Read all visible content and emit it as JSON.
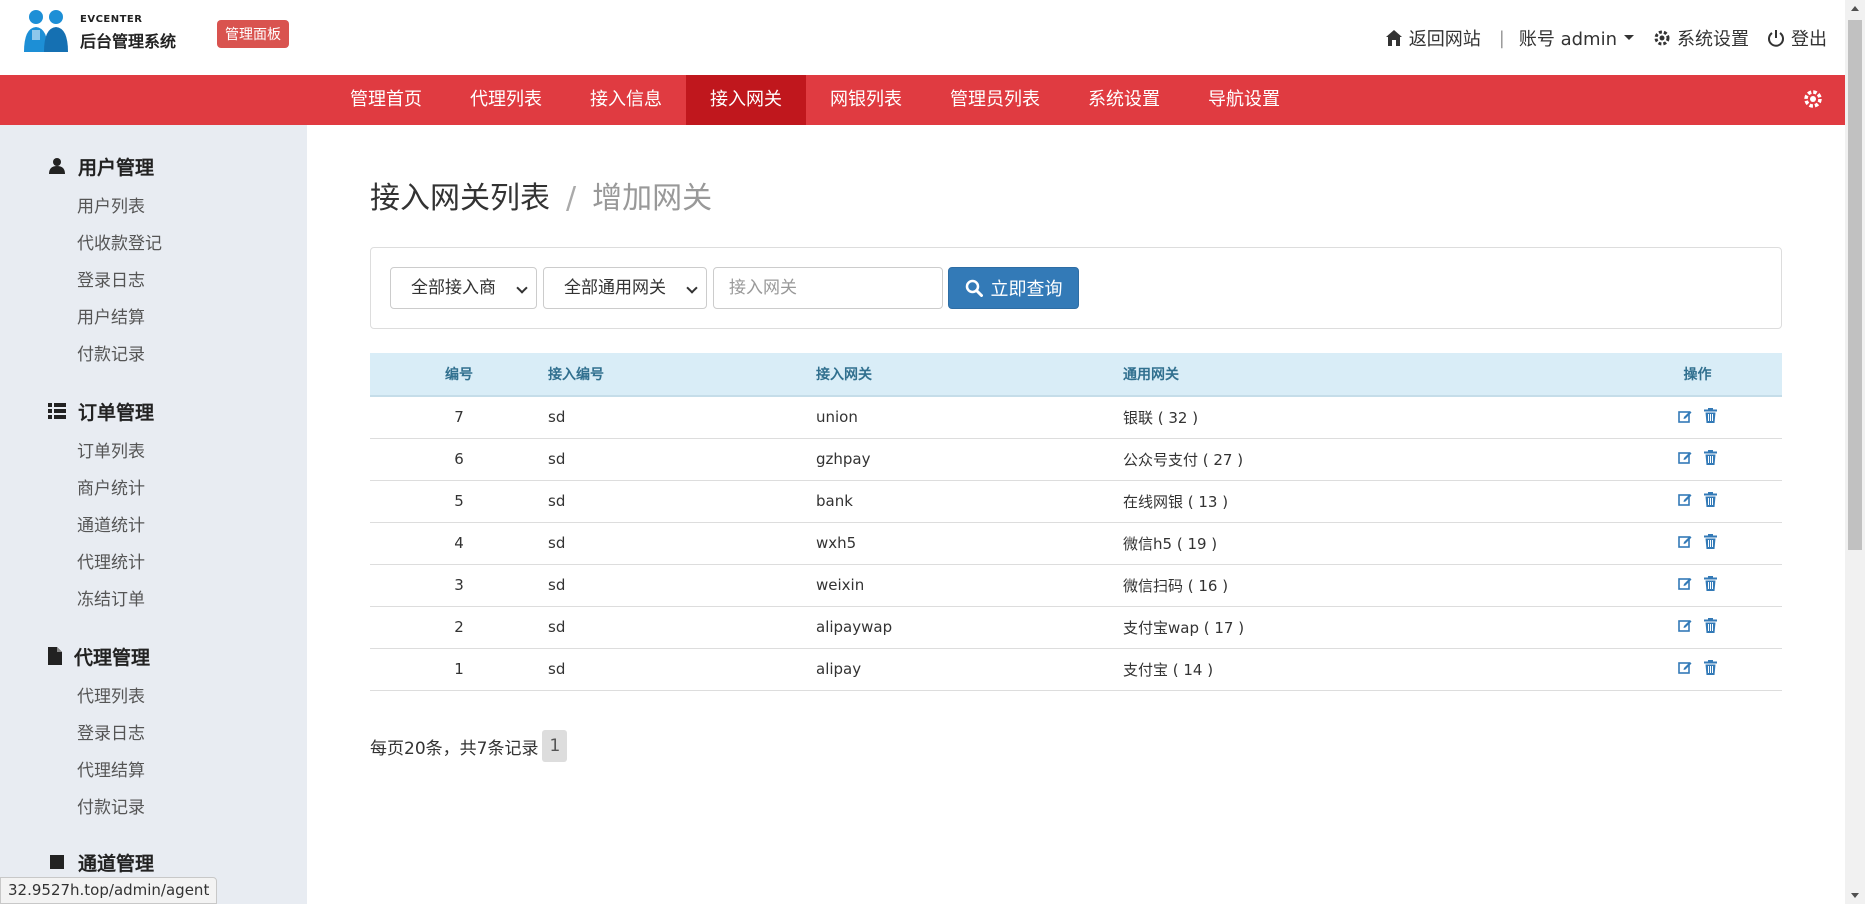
{
  "header": {
    "brand_small": "EVCENTER",
    "brand_main": "后台管理系统",
    "badge": "管理面板",
    "links": {
      "back": "返回网站",
      "account": "账号 admin",
      "settings": "系统设置",
      "logout": "登出"
    }
  },
  "main_nav": {
    "items": [
      "管理首页",
      "代理列表",
      "接入信息",
      "接入网关",
      "网银列表",
      "管理员列表",
      "系统设置",
      "导航设置"
    ],
    "active": "接入网关"
  },
  "sidebar": {
    "groups": [
      {
        "title": "用户管理",
        "icon": "user-icon",
        "items": [
          "用户列表",
          "代收款登记",
          "登录日志",
          "用户结算",
          "付款记录"
        ]
      },
      {
        "title": "订单管理",
        "icon": "list-icon",
        "items": [
          "订单列表",
          "商户统计",
          "通道统计",
          "代理统计",
          "冻结订单"
        ]
      },
      {
        "title": "代理管理",
        "icon": "file-icon",
        "items": [
          "代理列表",
          "登录日志",
          "代理结算",
          "付款记录"
        ]
      },
      {
        "title": "通道管理",
        "icon": "channel-icon",
        "items": []
      }
    ]
  },
  "breadcrumb": {
    "current": "接入网关列表",
    "separator": "/",
    "link": "增加网关"
  },
  "filters": {
    "provider_select": "全部接入商",
    "gateway_select": "全部通用网关",
    "gateway_input_placeholder": "接入网关",
    "query_button": "立即查询"
  },
  "table": {
    "headers": [
      "编号",
      "接入编号",
      "接入网关",
      "通用网关",
      "操作"
    ],
    "rows": [
      {
        "id": "7",
        "code": "sd",
        "gateway": "union",
        "common": "银联 ( 32 )"
      },
      {
        "id": "6",
        "code": "sd",
        "gateway": "gzhpay",
        "common": "公众号支付 ( 27 )"
      },
      {
        "id": "5",
        "code": "sd",
        "gateway": "bank",
        "common": "在线网银 ( 13 )"
      },
      {
        "id": "4",
        "code": "sd",
        "gateway": "wxh5",
        "common": "微信h5 ( 19 )"
      },
      {
        "id": "3",
        "code": "sd",
        "gateway": "weixin",
        "common": "微信扫码 ( 16 )"
      },
      {
        "id": "2",
        "code": "sd",
        "gateway": "alipaywap",
        "common": "支付宝wap ( 17 )"
      },
      {
        "id": "1",
        "code": "sd",
        "gateway": "alipay",
        "common": "支付宝 ( 14 )"
      }
    ]
  },
  "pagination": {
    "summary": "每页20条，共7条记录",
    "current_page": "1"
  },
  "status_bar": {
    "url": "32.9527h.top/admin/agent"
  },
  "colors": {
    "nav_red": "#e03b41",
    "nav_active": "#c0171d",
    "primary_blue": "#337ab7",
    "table_head": "#d9edf7",
    "sidebar_bg": "#e8ecf2"
  }
}
